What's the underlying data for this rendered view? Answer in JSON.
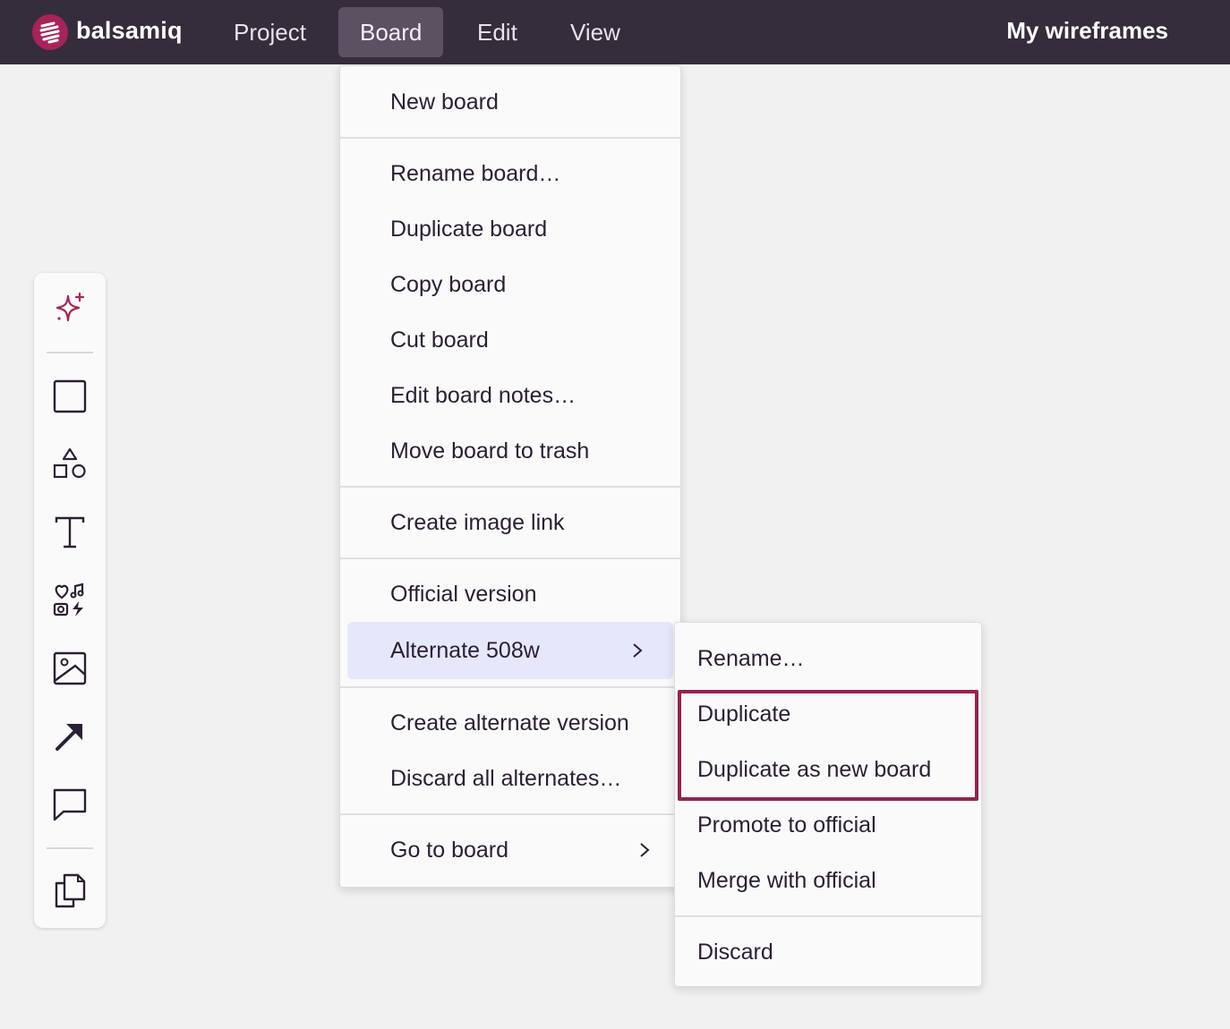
{
  "app": {
    "brand": "balsamiq",
    "right_title": "My wireframes"
  },
  "menubar": {
    "items": [
      {
        "label": "Project"
      },
      {
        "label": "Board"
      },
      {
        "label": "Edit"
      },
      {
        "label": "View"
      }
    ],
    "active": "Board"
  },
  "toolbar": {
    "tools": [
      "ai-sparkle-icon",
      "rectangle-icon",
      "shapes-icon",
      "text-icon",
      "icons-library-icon",
      "image-icon",
      "arrow-icon",
      "comment-icon",
      "copy-pages-icon"
    ]
  },
  "board_menu": {
    "new_board": "New board",
    "rename": "Rename board…",
    "duplicate": "Duplicate board",
    "copy": "Copy board",
    "cut": "Cut board",
    "edit_notes": "Edit board notes…",
    "trash": "Move board to trash",
    "image_link": "Create image link",
    "official": "Official version",
    "alternate": "Alternate 508w",
    "create_alternate": "Create alternate version",
    "discard_all": "Discard all alternates…",
    "go_to_board": "Go to board"
  },
  "alternate_submenu": {
    "rename": "Rename…",
    "duplicate": "Duplicate",
    "duplicate_new": "Duplicate as new board",
    "promote": "Promote to official",
    "merge": "Merge with official",
    "discard": "Discard"
  },
  "colors": {
    "topbar": "#352d3b",
    "brand_accent": "#a6245a",
    "highlight_border": "#94234f",
    "hover_item": "#e5e8fa"
  }
}
